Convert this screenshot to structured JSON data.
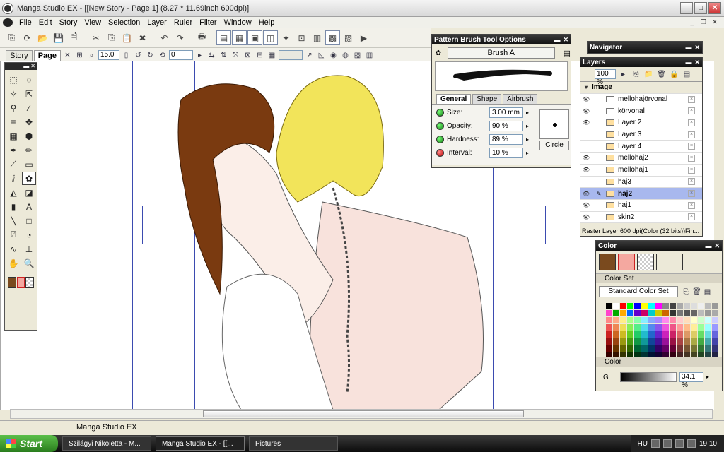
{
  "window": {
    "title": "Manga Studio EX - [[New Story - Page 1] (8.27 * 11.69inch 600dpi)]"
  },
  "menu": [
    "File",
    "Edit",
    "Story",
    "View",
    "Selection",
    "Layer",
    "Ruler",
    "Filter",
    "Window",
    "Help"
  ],
  "doc_tabs": {
    "story": "Story",
    "page": "Page"
  },
  "toolbar2": {
    "zoom_value": "15.0",
    "rotate_value": "0"
  },
  "brush_options": {
    "title": "Pattern Brush Tool Options",
    "brush_name": "Brush A",
    "tabs": [
      "General",
      "Shape",
      "Airbrush"
    ],
    "params": [
      {
        "label": "Size:",
        "value": "3.00 mm",
        "status": "green"
      },
      {
        "label": "Opacity:",
        "value": "90 %",
        "status": "green"
      },
      {
        "label": "Hardness:",
        "value": "89 %",
        "status": "green"
      },
      {
        "label": "Interval:",
        "value": "10 %",
        "status": "red"
      }
    ],
    "shape_button": "Circle"
  },
  "navigator": {
    "title": "Navigator"
  },
  "layers": {
    "title": "Layers",
    "opacity": "100 %",
    "group": "Image",
    "items": [
      {
        "name": "mellohajörvonal",
        "visible": true,
        "raster": false
      },
      {
        "name": "körvonal",
        "visible": true,
        "raster": false
      },
      {
        "name": "Layer 2",
        "visible": true,
        "raster": true
      },
      {
        "name": "Layer 3",
        "visible": false,
        "raster": true
      },
      {
        "name": "Layer 4",
        "visible": false,
        "raster": true
      },
      {
        "name": "mellohaj2",
        "visible": true,
        "raster": true
      },
      {
        "name": "mellohaj1",
        "visible": true,
        "raster": true
      },
      {
        "name": "haj3",
        "visible": false,
        "raster": true
      },
      {
        "name": "haj2",
        "visible": true,
        "raster": true,
        "selected": true
      },
      {
        "name": "haj1",
        "visible": true,
        "raster": true
      },
      {
        "name": "skin2",
        "visible": true,
        "raster": true
      }
    ],
    "status": "Raster Layer 600 dpi(Color (32 bits))Fin..."
  },
  "color": {
    "title": "Color",
    "set_header": "Color Set",
    "set_name": "Standard Color Set",
    "color_header": "Color",
    "channel": "G",
    "channel_value": "34.1 %",
    "main_color": "#7a4a1e",
    "sub_color": "#f4a8a0"
  },
  "statusbar": {
    "text": "Manga Studio EX"
  },
  "taskbar": {
    "start": "Start",
    "tasks": [
      "Szilágyi Nikoletta - M...",
      "Manga Studio EX - [[...",
      "Pictures"
    ],
    "tray_lang": "HU",
    "clock": "19:10"
  }
}
